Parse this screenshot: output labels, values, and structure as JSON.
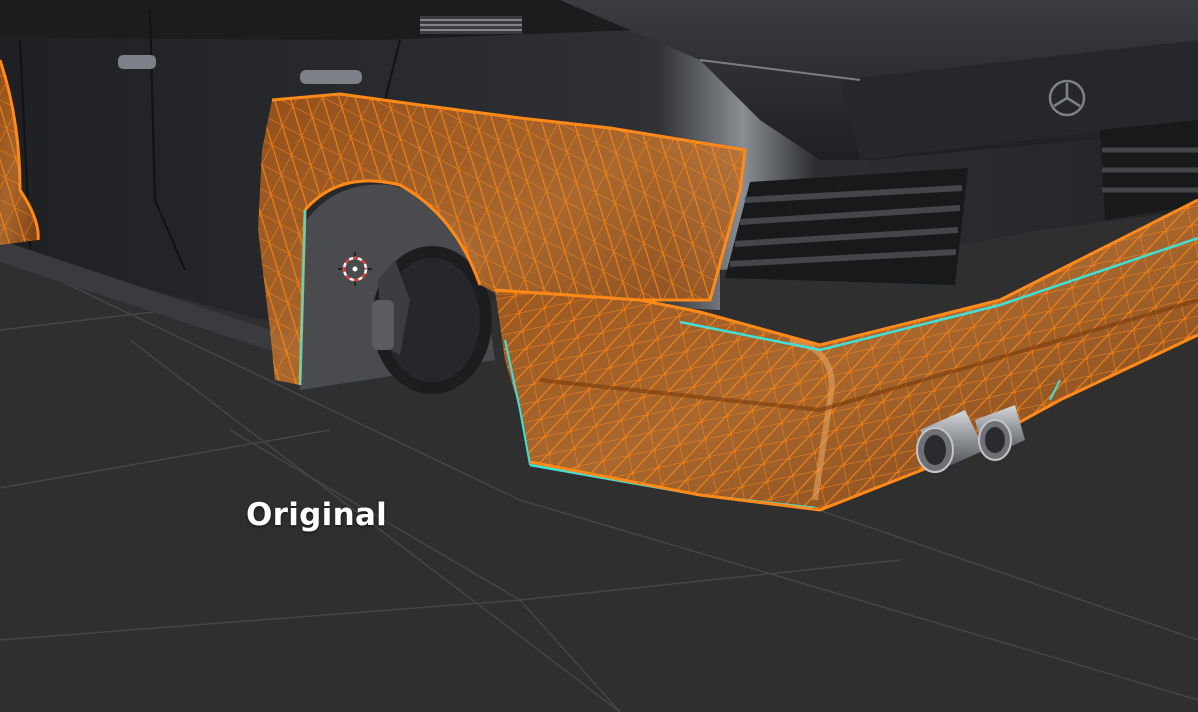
{
  "overlay": {
    "label": "Original"
  },
  "colors": {
    "background": "#2f2f30",
    "grid_line": "#4a4a4c",
    "car_body": "#2a2b2e",
    "car_highlight": "#6b6e74",
    "mesh_fill": "#b8631e",
    "mesh_wire": "#ff8a1a",
    "boundary_edge": "#3fe0d8",
    "exhaust": "#a9abb0"
  },
  "icons": [
    "3d-cursor-icon",
    "mercedes-star-icon"
  ]
}
